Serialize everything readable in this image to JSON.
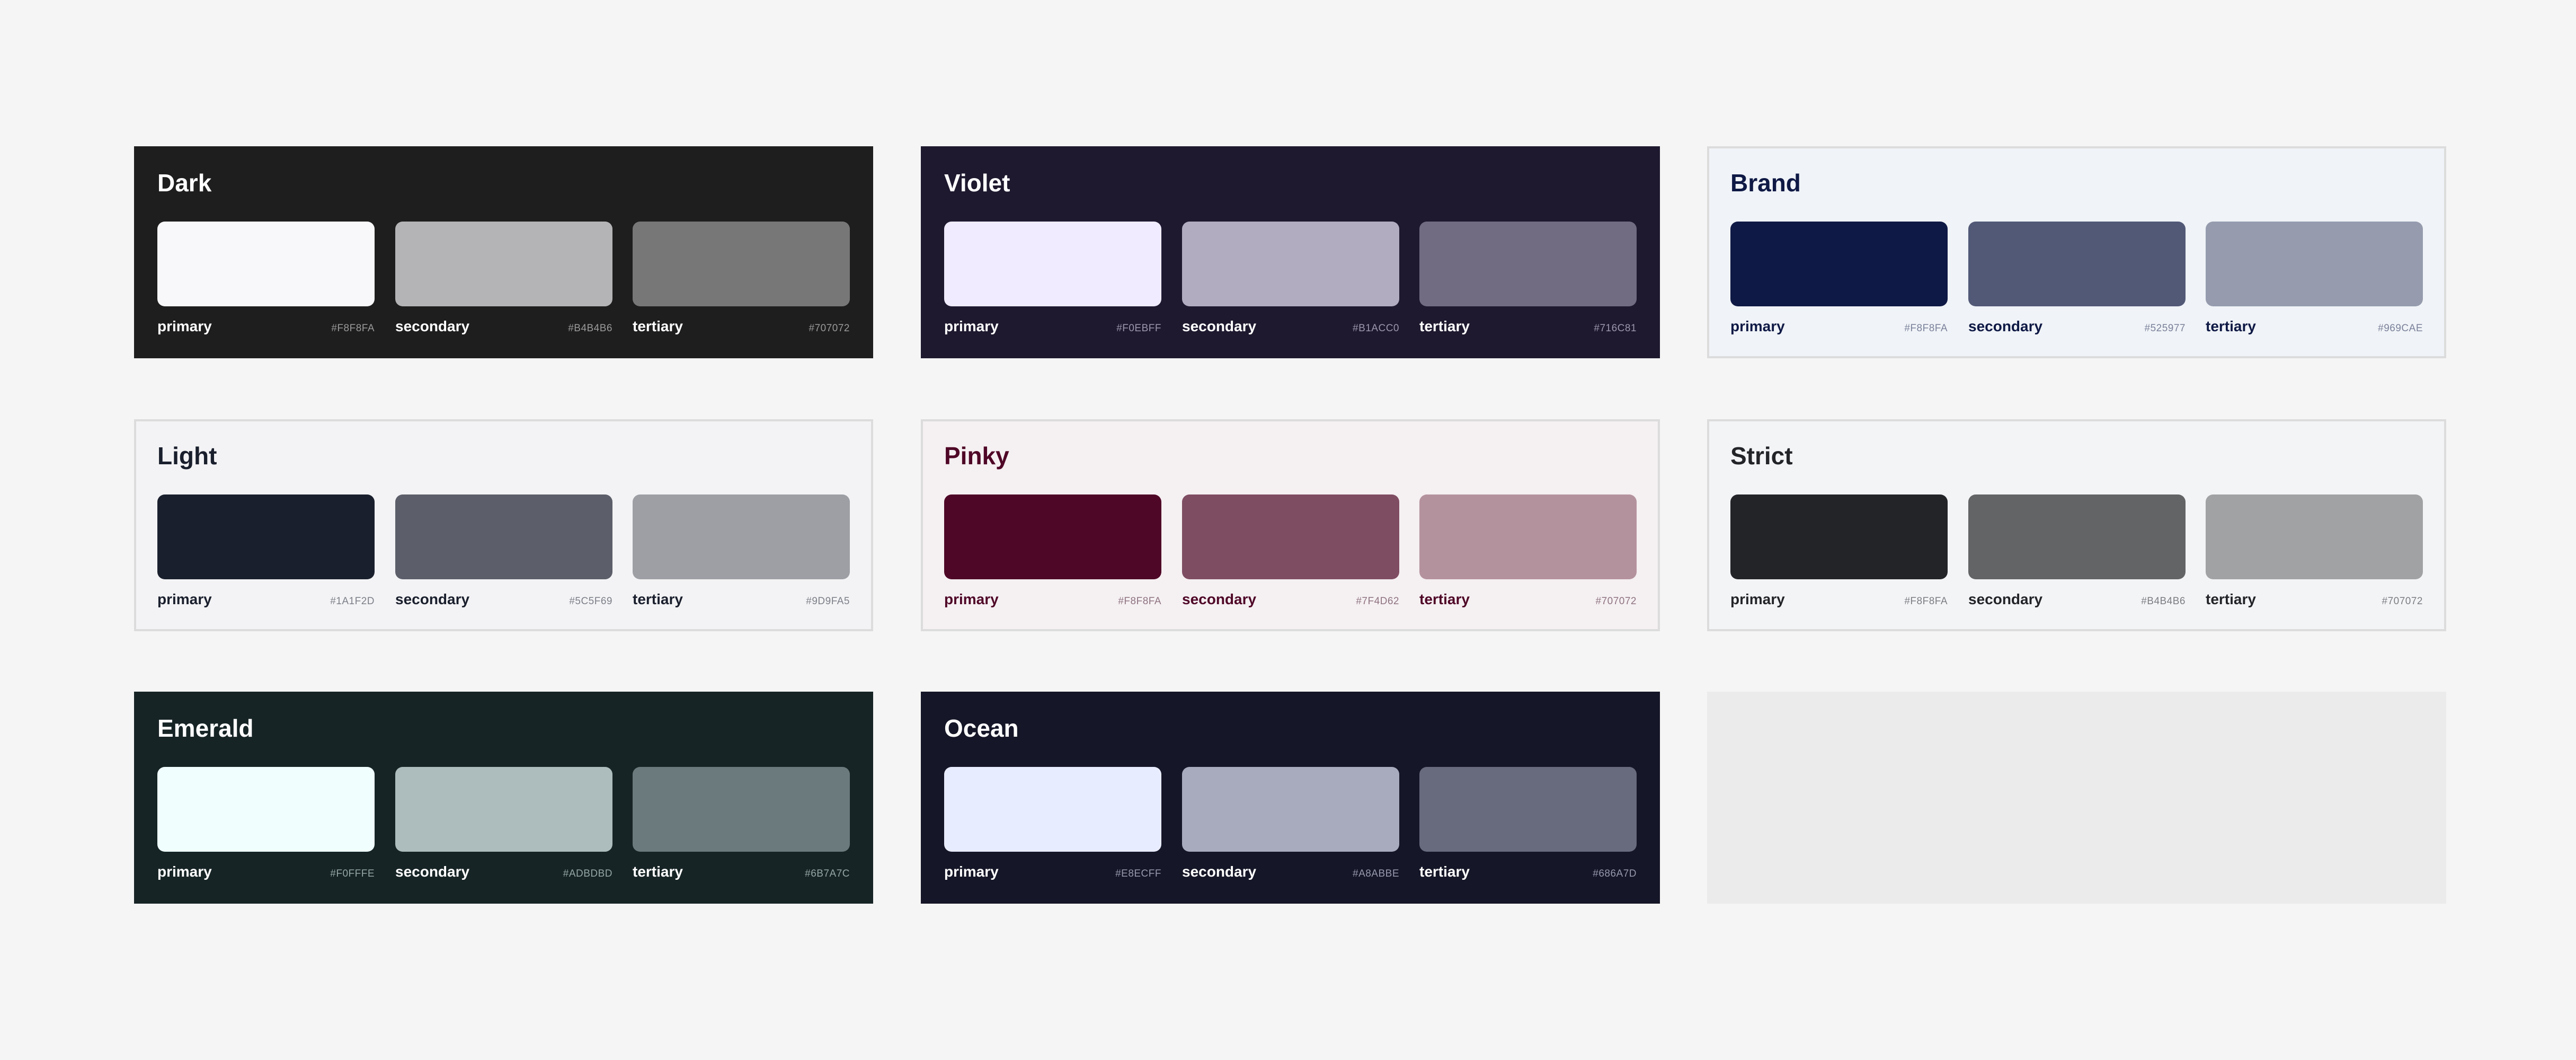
{
  "cards": [
    {
      "title": "Dark",
      "bg": "#1E1E1E",
      "title_color": "#FFFFFF",
      "label_color": "#FFFFFF",
      "hex_color": "#9A9A9A",
      "bordered": false,
      "swatches": [
        {
          "name": "primary",
          "hex": "#F8F8FA",
          "color": "#F8F8FA"
        },
        {
          "name": "secondary",
          "hex": "#B4B4B6",
          "color": "#B4B4B6"
        },
        {
          "name": "tertiary",
          "hex": "#707072",
          "color": "#777777"
        }
      ]
    },
    {
      "title": "Violet",
      "bg": "#1F192F",
      "title_color": "#FFFFFF",
      "label_color": "#FFFFFF",
      "hex_color": "#9C96AE",
      "bordered": false,
      "swatches": [
        {
          "name": "primary",
          "hex": "#F0EBFF",
          "color": "#F0EBFF"
        },
        {
          "name": "secondary",
          "hex": "#B1ACC0",
          "color": "#B1ACC0"
        },
        {
          "name": "tertiary",
          "hex": "#716C81",
          "color": "#716C81"
        }
      ]
    },
    {
      "title": "Brand",
      "bg": "#F0F3F7",
      "title_color": "#0F1945",
      "label_color": "#0F1945",
      "hex_color": "#7A819A",
      "bordered": true,
      "swatches": [
        {
          "name": "primary",
          "hex": "#F8F8FA",
          "color": "#0F1945"
        },
        {
          "name": "secondary",
          "hex": "#525977",
          "color": "#525977"
        },
        {
          "name": "tertiary",
          "hex": "#969CAE",
          "color": "#969CAE"
        }
      ]
    },
    {
      "title": "Light",
      "bg": "#F3F3F5",
      "title_color": "#1A1F2D",
      "label_color": "#1A1F2D",
      "hex_color": "#7C7F88",
      "bordered": true,
      "swatches": [
        {
          "name": "primary",
          "hex": "#1A1F2D",
          "color": "#1A1F2D"
        },
        {
          "name": "secondary",
          "hex": "#5C5F69",
          "color": "#5C5F69"
        },
        {
          "name": "tertiary",
          "hex": "#9D9FA5",
          "color": "#9D9FA5"
        }
      ]
    },
    {
      "title": "Pinky",
      "bg": "#F5F0F2",
      "title_color": "#4F0727",
      "label_color": "#4F0727",
      "hex_color": "#8E7381",
      "bordered": true,
      "swatches": [
        {
          "name": "primary",
          "hex": "#F8F8FA",
          "color": "#4F0727"
        },
        {
          "name": "secondary",
          "hex": "#7F4D62",
          "color": "#7F4D62"
        },
        {
          "name": "tertiary",
          "hex": "#707072",
          "color": "#B4929D"
        }
      ]
    },
    {
      "title": "Strict",
      "bg": "#F3F4F6",
      "title_color": "#232428",
      "label_color": "#232428",
      "hex_color": "#7C7D82",
      "bordered": true,
      "swatches": [
        {
          "name": "primary",
          "hex": "#F8F8FA",
          "color": "#232428"
        },
        {
          "name": "secondary",
          "hex": "#B4B4B6",
          "color": "#636466"
        },
        {
          "name": "tertiary",
          "hex": "#707072",
          "color": "#A1A2A4"
        }
      ]
    },
    {
      "title": "Emerald",
      "bg": "#172426",
      "title_color": "#FFFFFF",
      "label_color": "#FFFFFF",
      "hex_color": "#94A6A6",
      "bordered": false,
      "swatches": [
        {
          "name": "primary",
          "hex": "#F0FFFE",
          "color": "#F0FFFE"
        },
        {
          "name": "secondary",
          "hex": "#ADBDBD",
          "color": "#ADBDBD"
        },
        {
          "name": "tertiary",
          "hex": "#6B7A7C",
          "color": "#6B7A7C"
        }
      ]
    },
    {
      "title": "Ocean",
      "bg": "#151627",
      "title_color": "#FFFFFF",
      "label_color": "#FFFFFF",
      "hex_color": "#9799AE",
      "bordered": false,
      "swatches": [
        {
          "name": "primary",
          "hex": "#E8ECFF",
          "color": "#E8ECFF"
        },
        {
          "name": "secondary",
          "hex": "#A8ABBE",
          "color": "#A8ABBE"
        },
        {
          "name": "tertiary",
          "hex": "#686A7D",
          "color": "#686A7D"
        }
      ]
    }
  ],
  "placeholder": {
    "bg": "#EBEBEB"
  }
}
